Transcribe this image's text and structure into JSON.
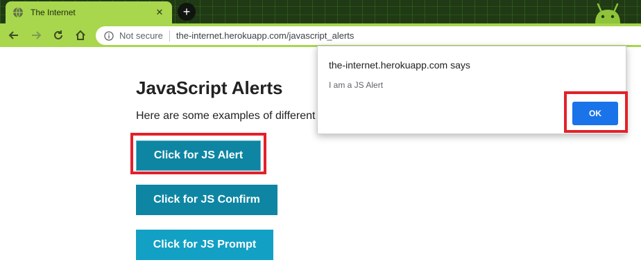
{
  "browser": {
    "tab_title": "The Internet",
    "tab_close_glyph": "✕",
    "new_tab_glyph": "+",
    "security_label": "Not secure",
    "url": "the-internet.herokuapp.com/javascript_alerts",
    "theme_color": "#a8d64d",
    "icons": [
      "globe-icon",
      "close-icon",
      "plus-icon",
      "back-icon",
      "forward-icon",
      "reload-icon",
      "home-icon",
      "info-icon",
      "android-mascot-icon"
    ]
  },
  "page": {
    "title": "JavaScript Alerts",
    "intro": "Here are some examples of different",
    "buttons": {
      "alert": "Click for JS Alert",
      "confirm": "Click for JS Confirm",
      "prompt": "Click for JS Prompt"
    },
    "button_color": "#0e86a3"
  },
  "dialog": {
    "title": "the-internet.herokuapp.com says",
    "message": "I am a JS Alert",
    "ok_label": "OK",
    "ok_color": "#1a73e8"
  },
  "annotations": {
    "highlight_color": "#e3202a"
  }
}
